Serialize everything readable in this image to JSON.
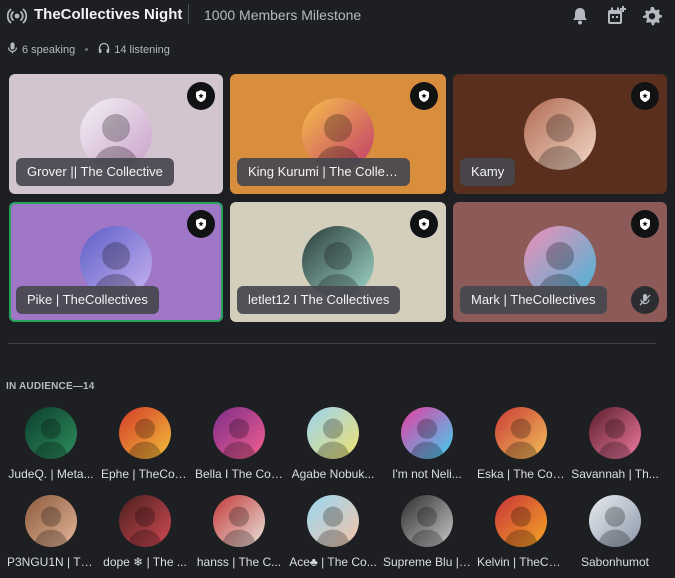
{
  "header": {
    "title": "TheCollectives Night",
    "topic": "1000 Members Milestone",
    "icons": [
      "stage-icon",
      "bell-icon",
      "calendar-add-icon",
      "gear-icon"
    ]
  },
  "stats": {
    "speaking": "6 speaking",
    "listening": "14 listening"
  },
  "speakers": [
    {
      "name": "Grover || The Collective",
      "bg": "#d3c5d0",
      "moderator": true
    },
    {
      "name": "King Kurumi | The Collecti...",
      "bg": "#d98e3e",
      "moderator": true
    },
    {
      "name": "Kamy",
      "bg": "#5a2f1d",
      "moderator": true
    },
    {
      "name": "Pike | TheCollectives",
      "bg": "#a077c7",
      "moderator": true,
      "active": true
    },
    {
      "name": "letlet12 I The Collectives",
      "bg": "#d4cfbd",
      "moderator": true
    },
    {
      "name": "Mark | TheCollectives",
      "bg": "#8c5b57",
      "moderator": true,
      "muted": true
    }
  ],
  "audience_label": "IN AUDIENCE—14",
  "audience": [
    {
      "name": "JudeQ. | Meta..."
    },
    {
      "name": "Ephe | TheColl..."
    },
    {
      "name": "Bella I The Col..."
    },
    {
      "name": "Agabe Nobuk..."
    },
    {
      "name": "I'm not Neli..."
    },
    {
      "name": "Eska | The Col..."
    },
    {
      "name": "Savannah | Th..."
    },
    {
      "name": "P3NGU1N | Th..."
    },
    {
      "name": "dope ❄ | The ..."
    },
    {
      "name": "hanss | The C..."
    },
    {
      "name": "Ace♣ | The Co..."
    },
    {
      "name": "Supreme Blu | ..."
    },
    {
      "name": "Kelvin | TheCo..."
    },
    {
      "name": "Sabonhumot"
    }
  ],
  "colors": {
    "background": "#1e1f22",
    "speaking_ring": "#23a55a"
  }
}
